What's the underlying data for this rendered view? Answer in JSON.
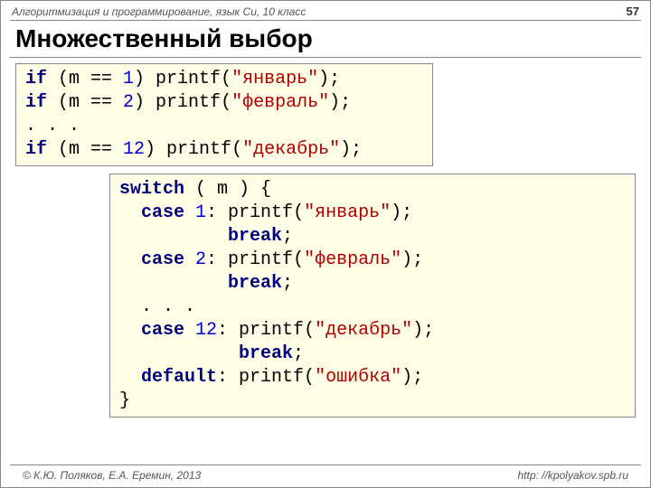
{
  "header": {
    "course": "Алгоритмизация и программирование, язык Си, 10 класс",
    "page": "57"
  },
  "title": "Множественный выбор",
  "code1": {
    "l1a": "if",
    "l1b": " (m == ",
    "l1c": "1",
    "l1d": ") printf(",
    "l1e": "\"январь\"",
    "l1f": ");",
    "l2a": "if",
    "l2b": " (m == ",
    "l2c": "2",
    "l2d": ") printf(",
    "l2e": "\"февраль\"",
    "l2f": ");",
    "l3": ". . .",
    "l4a": "if",
    "l4b": " (m == ",
    "l4c": "12",
    "l4d": ") printf(",
    "l4e": "\"декабрь\"",
    "l4f": ");"
  },
  "code2": {
    "l1a": "switch",
    "l1b": " ( m ) {",
    "l2a": "  case",
    "l2b": " ",
    "l2c": "1",
    "l2d": ": printf(",
    "l2e": "\"январь\"",
    "l2f": ");",
    "l3a": "          ",
    "l3b": "break",
    "l3c": ";",
    "l4a": "  case",
    "l4b": " ",
    "l4c": "2",
    "l4d": ": printf(",
    "l4e": "\"февраль\"",
    "l4f": ");",
    "l5a": "          ",
    "l5b": "break",
    "l5c": ";",
    "l6": "  . . .",
    "l7a": "  case",
    "l7b": " ",
    "l7c": "12",
    "l7d": ": printf(",
    "l7e": "\"декабрь\"",
    "l7f": ");",
    "l8a": "           ",
    "l8b": "break",
    "l8c": ";",
    "l9a": "  default",
    "l9b": ": printf(",
    "l9c": "\"ошибка\"",
    "l9d": ");",
    "l10": "}"
  },
  "footer": {
    "copyright": "© К.Ю. Поляков, Е.А. Еремин, 2013",
    "url": "http: //kpolyakov.spb.ru"
  }
}
